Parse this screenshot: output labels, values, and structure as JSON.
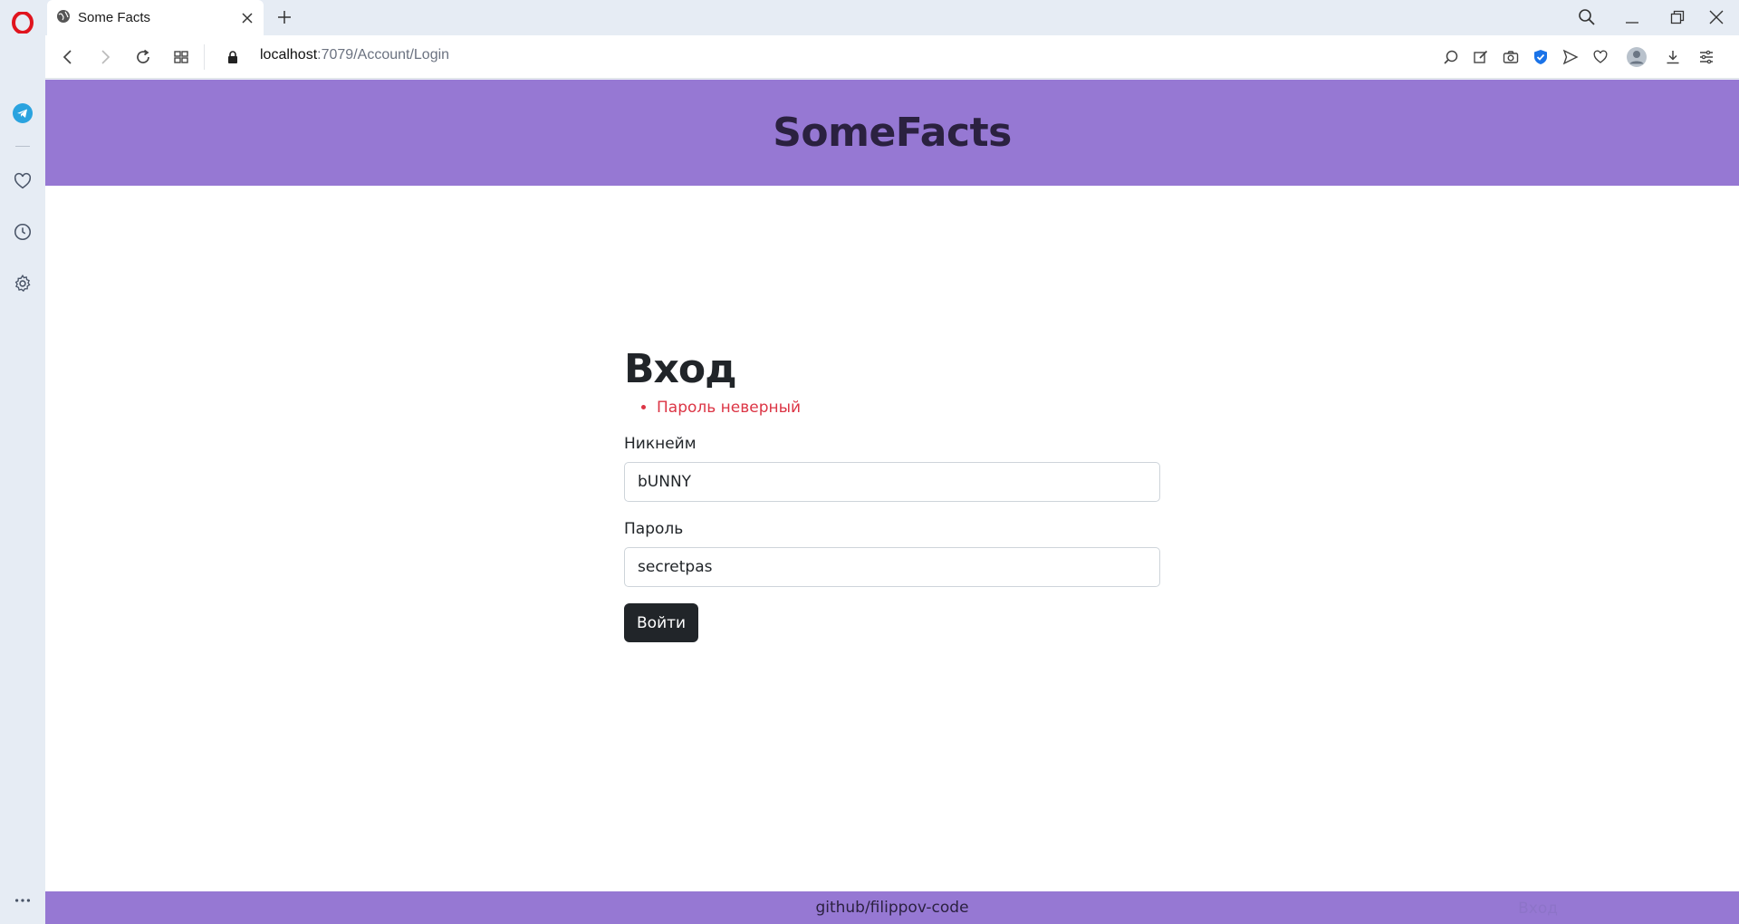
{
  "browser": {
    "tab": {
      "title": "Some Facts"
    },
    "address": {
      "host": "localhost",
      "rest": ":7079/Account/Login"
    }
  },
  "site": {
    "brand": "SomeFacts",
    "footer_link": "github/filippov-code",
    "footer_login": "Вход"
  },
  "login": {
    "heading": "Вход",
    "errors": [
      "Пароль неверный"
    ],
    "username": {
      "label": "Никнейм",
      "value": "bUNNY"
    },
    "password": {
      "label": "Пароль",
      "value": "secretpas"
    },
    "submit_label": "Войти"
  },
  "colors": {
    "header_bg": "#9678d3",
    "error": "#dc3545",
    "button_bg": "#212529",
    "opera_red": "#e0141e",
    "telegram": "#2aa3df",
    "vpn_blue": "#1a73e8"
  },
  "icons": {
    "sidebar": [
      "opera-logo-icon",
      "telegram-icon",
      "heart-icon",
      "history-icon",
      "settings-icon",
      "more-icon"
    ],
    "toolbar": [
      "lens-icon",
      "edit-icon",
      "camera-icon",
      "vpn-shield-icon",
      "send-icon",
      "heart-icon",
      "profile-icon",
      "download-icon",
      "easy-setup-icon"
    ]
  }
}
